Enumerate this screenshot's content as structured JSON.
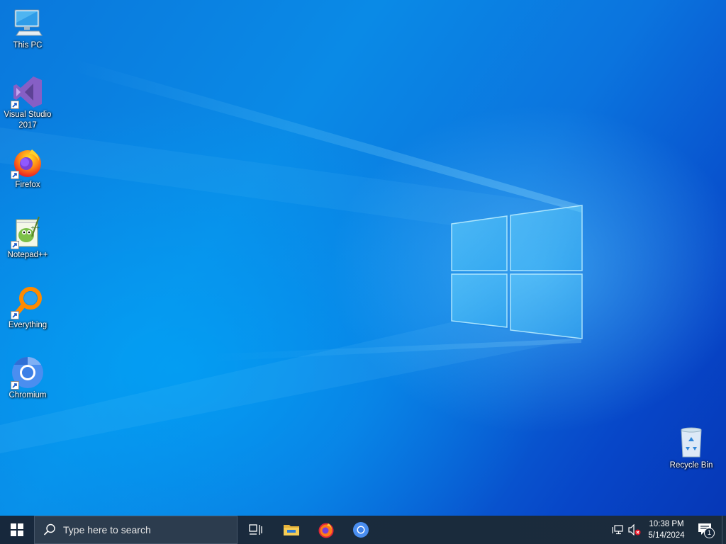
{
  "desktop": {
    "icons": [
      {
        "label": "This PC",
        "icon": "monitor-icon"
      },
      {
        "label": "Visual Studio 2017",
        "icon": "visual-studio-icon"
      },
      {
        "label": "Firefox",
        "icon": "firefox-icon"
      },
      {
        "label": "Notepad++",
        "icon": "notepad-plus-plus-icon"
      },
      {
        "label": "Everything",
        "icon": "everything-search-icon"
      },
      {
        "label": "Chromium",
        "icon": "chromium-icon"
      },
      {
        "label": "Recycle Bin",
        "icon": "recycle-bin-icon"
      }
    ]
  },
  "taskbar": {
    "search_placeholder": "Type here to search",
    "pinned": [
      "task-view-icon",
      "file-explorer-icon",
      "firefox-icon",
      "chromium-icon"
    ],
    "clock": {
      "time": "10:38 PM",
      "date": "5/14/2024"
    },
    "notification_count": "1"
  },
  "colors": {
    "taskbar_bg": "#17283c",
    "desktop_blue": "#0a78dc"
  }
}
